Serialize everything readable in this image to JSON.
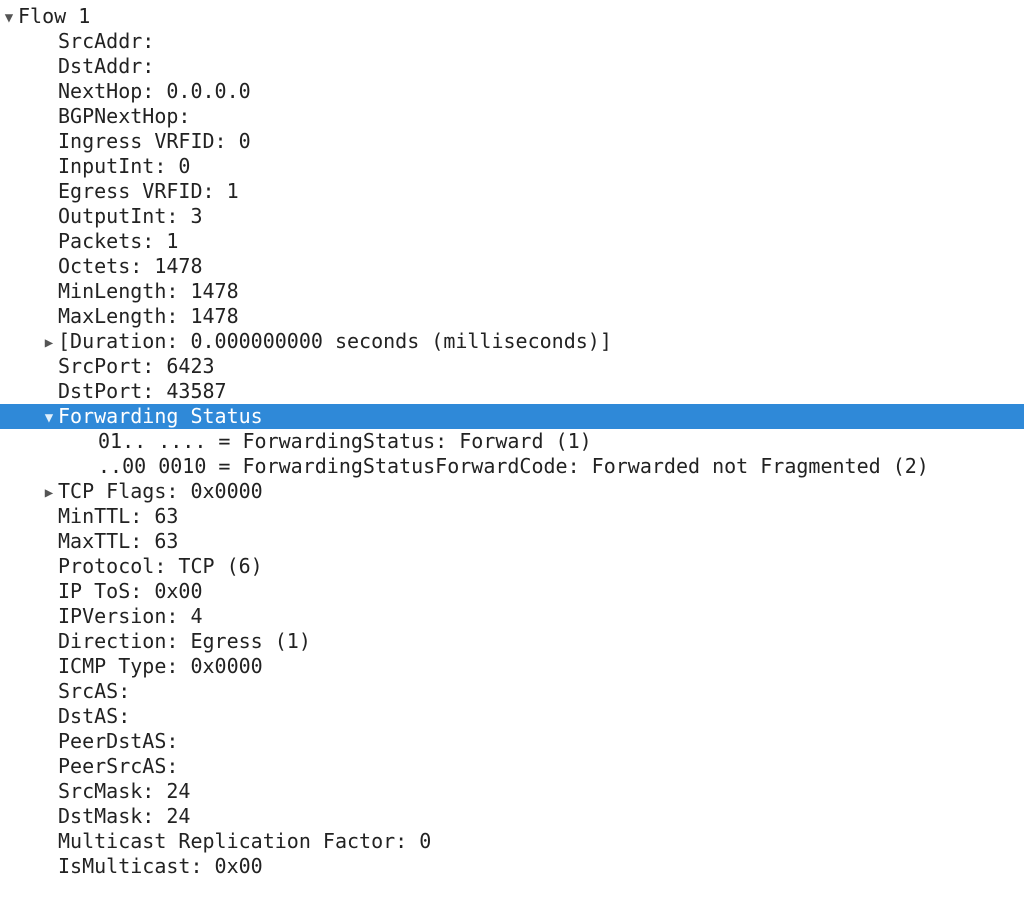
{
  "lines": [
    {
      "depth": 0,
      "arrow": "down",
      "selected": false,
      "name": "flow-header",
      "text": "Flow 1"
    },
    {
      "depth": 1,
      "arrow": "none",
      "selected": false,
      "name": "field-srcaddr",
      "text": "SrcAddr:"
    },
    {
      "depth": 1,
      "arrow": "none",
      "selected": false,
      "name": "field-dstaddr",
      "text": "DstAddr:"
    },
    {
      "depth": 1,
      "arrow": "none",
      "selected": false,
      "name": "field-nexthop",
      "text": "NextHop: 0.0.0.0"
    },
    {
      "depth": 1,
      "arrow": "none",
      "selected": false,
      "name": "field-bgpnexthop",
      "text": "BGPNextHop:"
    },
    {
      "depth": 1,
      "arrow": "none",
      "selected": false,
      "name": "field-ingressvrfid",
      "text": "Ingress VRFID: 0"
    },
    {
      "depth": 1,
      "arrow": "none",
      "selected": false,
      "name": "field-inputint",
      "text": "InputInt: 0"
    },
    {
      "depth": 1,
      "arrow": "none",
      "selected": false,
      "name": "field-egressvrfid",
      "text": "Egress VRFID: 1"
    },
    {
      "depth": 1,
      "arrow": "none",
      "selected": false,
      "name": "field-outputint",
      "text": "OutputInt: 3"
    },
    {
      "depth": 1,
      "arrow": "none",
      "selected": false,
      "name": "field-packets",
      "text": "Packets: 1"
    },
    {
      "depth": 1,
      "arrow": "none",
      "selected": false,
      "name": "field-octets",
      "text": "Octets: 1478"
    },
    {
      "depth": 1,
      "arrow": "none",
      "selected": false,
      "name": "field-minlength",
      "text": "MinLength: 1478"
    },
    {
      "depth": 1,
      "arrow": "none",
      "selected": false,
      "name": "field-maxlength",
      "text": "MaxLength: 1478"
    },
    {
      "depth": 1,
      "arrow": "right",
      "selected": false,
      "name": "field-duration",
      "text": "[Duration: 0.000000000 seconds (milliseconds)]"
    },
    {
      "depth": 1,
      "arrow": "none",
      "selected": false,
      "name": "field-srcport",
      "text": "SrcPort: 6423"
    },
    {
      "depth": 1,
      "arrow": "none",
      "selected": false,
      "name": "field-dstport",
      "text": "DstPort: 43587"
    },
    {
      "depth": 1,
      "arrow": "down",
      "selected": true,
      "name": "field-forwarding-status",
      "text": "Forwarding Status"
    },
    {
      "depth": 2,
      "arrow": "none",
      "selected": false,
      "name": "field-fwdstatus-bits",
      "text": "01.. .... = ForwardingStatus: Forward (1)"
    },
    {
      "depth": 2,
      "arrow": "none",
      "selected": false,
      "name": "field-fwdstatuscode-bits",
      "text": "..00 0010 = ForwardingStatusForwardCode: Forwarded not Fragmented (2)"
    },
    {
      "depth": 1,
      "arrow": "right",
      "selected": false,
      "name": "field-tcpflags",
      "text": "TCP Flags: 0x0000"
    },
    {
      "depth": 1,
      "arrow": "none",
      "selected": false,
      "name": "field-minttl",
      "text": "MinTTL: 63"
    },
    {
      "depth": 1,
      "arrow": "none",
      "selected": false,
      "name": "field-maxttl",
      "text": "MaxTTL: 63"
    },
    {
      "depth": 1,
      "arrow": "none",
      "selected": false,
      "name": "field-protocol",
      "text": "Protocol: TCP (6)"
    },
    {
      "depth": 1,
      "arrow": "none",
      "selected": false,
      "name": "field-iptos",
      "text": "IP ToS: 0x00"
    },
    {
      "depth": 1,
      "arrow": "none",
      "selected": false,
      "name": "field-ipversion",
      "text": "IPVersion: 4"
    },
    {
      "depth": 1,
      "arrow": "none",
      "selected": false,
      "name": "field-direction",
      "text": "Direction: Egress (1)"
    },
    {
      "depth": 1,
      "arrow": "none",
      "selected": false,
      "name": "field-icmptype",
      "text": "ICMP Type: 0x0000"
    },
    {
      "depth": 1,
      "arrow": "none",
      "selected": false,
      "name": "field-srcas",
      "text": "SrcAS:"
    },
    {
      "depth": 1,
      "arrow": "none",
      "selected": false,
      "name": "field-dstas",
      "text": "DstAS:"
    },
    {
      "depth": 1,
      "arrow": "none",
      "selected": false,
      "name": "field-peerdstas",
      "text": "PeerDstAS:"
    },
    {
      "depth": 1,
      "arrow": "none",
      "selected": false,
      "name": "field-peersrcas",
      "text": "PeerSrcAS:"
    },
    {
      "depth": 1,
      "arrow": "none",
      "selected": false,
      "name": "field-srcmask",
      "text": "SrcMask: 24"
    },
    {
      "depth": 1,
      "arrow": "none",
      "selected": false,
      "name": "field-dstmask",
      "text": "DstMask: 24"
    },
    {
      "depth": 1,
      "arrow": "none",
      "selected": false,
      "name": "field-multirepl",
      "text": "Multicast Replication Factor: 0"
    },
    {
      "depth": 1,
      "arrow": "none",
      "selected": false,
      "name": "field-ismulticast",
      "text": "IsMulticast: 0x00"
    }
  ],
  "arrow_glyphs": {
    "down": "▼",
    "right": "▶",
    "none": "▶"
  }
}
